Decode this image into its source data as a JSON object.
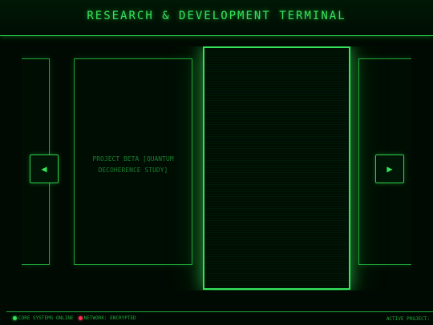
{
  "header": {
    "title": "RESEARCH & DEVELOPMENT TERMINAL"
  },
  "carousel": {
    "cards": [
      {
        "label": ""
      },
      {
        "label": "PROJECT BETA [QUANTUM DECOHERENCE STUDY]"
      },
      {
        "label": ""
      },
      {
        "label": ""
      }
    ],
    "prev_icon": "◀",
    "next_icon": "▶"
  },
  "footer": {
    "status_core": "CORE SYSTEMS ONLINE",
    "status_network": "NETWORK: ENCRYPTED",
    "active_project": "ACTIVE PROJECT:"
  },
  "colors": {
    "accent": "#35e25a",
    "background": "#000a02",
    "alert": "#ff2d55"
  }
}
